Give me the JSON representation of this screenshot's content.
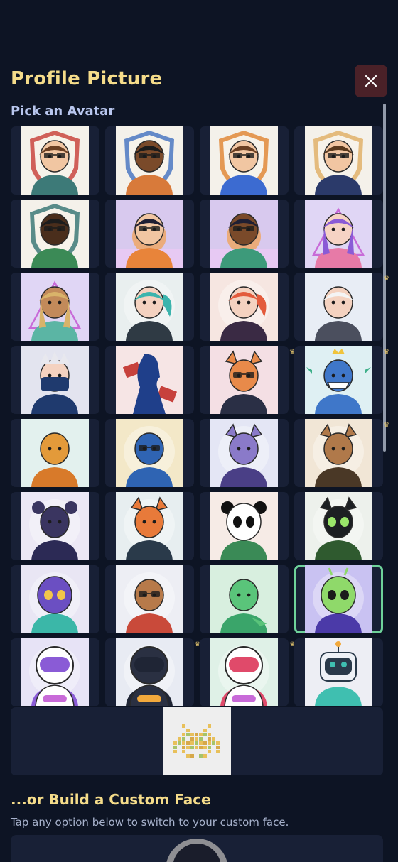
{
  "header": {
    "title": "Profile Picture",
    "close_icon": "close-icon"
  },
  "avatar_section": {
    "heading": "Pick an Avatar",
    "selected_index": 27,
    "avatars": [
      {
        "name": "shield-glasses-brown-hair",
        "premium": false
      },
      {
        "name": "shield-glasses-dark-skin",
        "premium": false
      },
      {
        "name": "shield-glasses-blue-shirt",
        "premium": false
      },
      {
        "name": "shield-bearded",
        "premium": false
      },
      {
        "name": "shield-green-shirt",
        "premium": false
      },
      {
        "name": "retro-gamer-spiky",
        "premium": false
      },
      {
        "name": "retro-gamer-dark",
        "premium": false
      },
      {
        "name": "purple-hair-triangle",
        "premium": false
      },
      {
        "name": "blonde-triangle",
        "premium": false
      },
      {
        "name": "teal-ponytail",
        "premium": false
      },
      {
        "name": "red-ponytail",
        "premium": false
      },
      {
        "name": "white-hair-armor",
        "premium": true
      },
      {
        "name": "masked-ninja",
        "premium": false
      },
      {
        "name": "blue-silhouette",
        "premium": false
      },
      {
        "name": "fox-sunglasses",
        "premium": true
      },
      {
        "name": "shark-king",
        "premium": true
      },
      {
        "name": "aviator-bird",
        "premium": false
      },
      {
        "name": "blue-bird-hat",
        "premium": false
      },
      {
        "name": "purple-wolf",
        "premium": false
      },
      {
        "name": "brown-fox-hood",
        "premium": true
      },
      {
        "name": "bear-hoodie",
        "premium": false
      },
      {
        "name": "orange-fox",
        "premium": false
      },
      {
        "name": "panda",
        "premium": false
      },
      {
        "name": "black-cat",
        "premium": false
      },
      {
        "name": "purple-owl",
        "premium": false
      },
      {
        "name": "aviator-dog",
        "premium": false
      },
      {
        "name": "green-dino",
        "premium": false
      },
      {
        "name": "green-alien",
        "premium": false
      },
      {
        "name": "astronaut-purple",
        "premium": false
      },
      {
        "name": "astronaut-gold",
        "premium": true
      },
      {
        "name": "astronaut-pink",
        "premium": true
      },
      {
        "name": "robot",
        "premium": false
      },
      {
        "name": "pixel-invader",
        "premium": false
      }
    ]
  },
  "custom_section": {
    "heading": "...or Build a Custom Face",
    "hint": "Tap any option below to switch to your custom face."
  },
  "colors": {
    "background": "#0d1424",
    "card": "#182036",
    "title_gold": "#f5dc8a",
    "selected_outline": "#6ed29a",
    "close_bg": "#4a2128"
  }
}
